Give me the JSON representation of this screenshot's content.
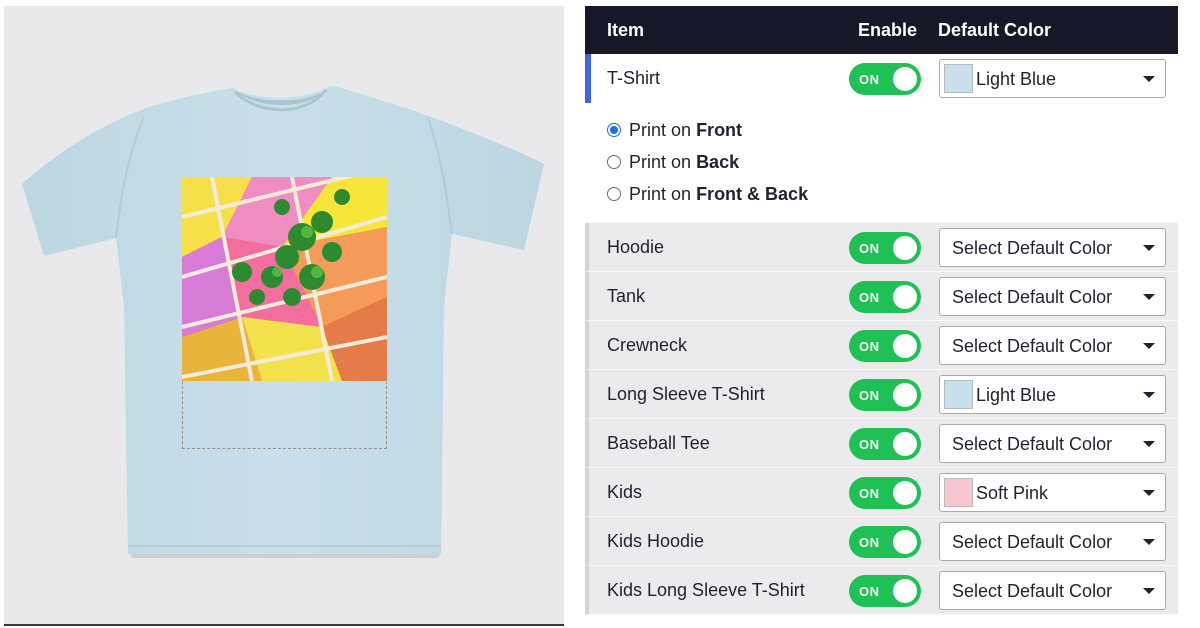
{
  "table": {
    "headers": {
      "item": "Item",
      "enable": "Enable",
      "default_color": "Default Color"
    }
  },
  "print_options": {
    "prefix": "Print on",
    "options": [
      {
        "label": "Front",
        "selected": true
      },
      {
        "label": "Back",
        "selected": false
      },
      {
        "label": "Front & Back",
        "selected": false
      }
    ]
  },
  "products": [
    {
      "name": "T-Shirt",
      "toggle": "ON",
      "color": "Light Blue",
      "swatch": "#c7e0ec",
      "active": true
    },
    {
      "name": "Hoodie",
      "toggle": "ON",
      "color": "Select Default Color"
    },
    {
      "name": "Tank",
      "toggle": "ON",
      "color": "Select Default Color"
    },
    {
      "name": "Crewneck",
      "toggle": "ON",
      "color": "Select Default Color"
    },
    {
      "name": "Long Sleeve T-Shirt",
      "toggle": "ON",
      "color": "Light Blue",
      "swatch": "#c7e0ec"
    },
    {
      "name": "Baseball Tee",
      "toggle": "ON",
      "color": "Select Default Color"
    },
    {
      "name": "Kids",
      "toggle": "ON",
      "color": "Soft Pink",
      "swatch": "#f7c5cf"
    },
    {
      "name": "Kids Hoodie",
      "toggle": "ON",
      "color": "Select Default Color"
    },
    {
      "name": "Kids Long Sleeve T-Shirt",
      "toggle": "ON",
      "color": "Select Default Color"
    }
  ],
  "colors": {
    "header_bg": "#161827",
    "toggle_on": "#1fc154",
    "active_accent": "#3f63e6",
    "shirt": "#c5dde8"
  }
}
